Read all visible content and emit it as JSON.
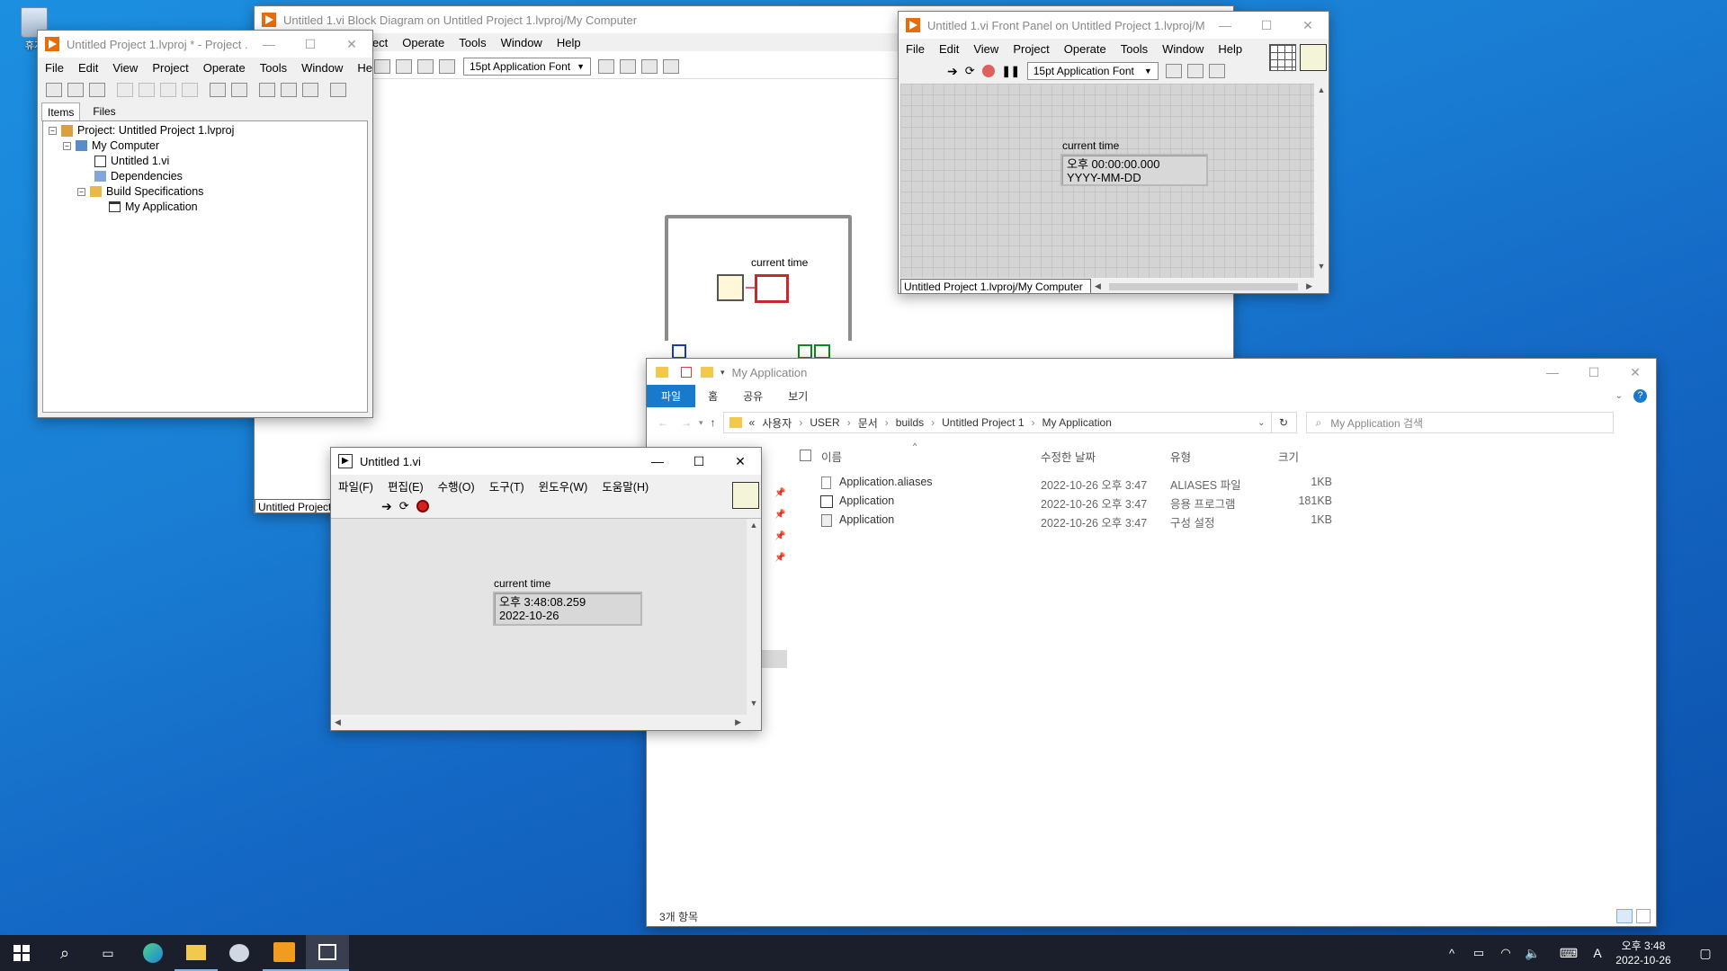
{
  "desktop": {
    "recycle_label": "휴지"
  },
  "project_window": {
    "title": "Untitled Project 1.lvproj * - Project ...",
    "menu": [
      "File",
      "Edit",
      "View",
      "Project",
      "Operate",
      "Tools",
      "Window",
      "Help"
    ],
    "tabs": [
      "Items",
      "Files"
    ],
    "tree": [
      "Project: Untitled Project 1.lvproj",
      "My Computer",
      "Untitled 1.vi",
      "Dependencies",
      "Build Specifications",
      "My Application"
    ]
  },
  "block_diagram": {
    "title": "Untitled 1.vi Block Diagram on Untitled Project 1.lvproj/My Computer",
    "menu": [
      "ject",
      "Operate",
      "Tools",
      "Window",
      "Help"
    ],
    "font": "15pt Application Font",
    "node_label": "current time",
    "status": "Untitled Project"
  },
  "front_panel": {
    "title": "Untitled 1.vi Front Panel on Untitled Project 1.lvproj/M...",
    "menu": [
      "File",
      "Edit",
      "View",
      "Project",
      "Operate",
      "Tools",
      "Window",
      "Help"
    ],
    "font": "15pt Application Font",
    "control_label": "current time",
    "control_time": "오후 00:00:00.000",
    "control_date": "YYYY-MM-DD",
    "status": "Untitled Project 1.lvproj/My Computer"
  },
  "running_vi": {
    "title": "Untitled 1.vi",
    "menu": [
      "파일(F)",
      "편집(E)",
      "수행(O)",
      "도구(T)",
      "윈도우(W)",
      "도움말(H)"
    ],
    "control_label": "current time",
    "control_time": "오후 3:48:08.259",
    "control_date": "2022-10-26"
  },
  "explorer": {
    "title": "My Application",
    "ribbon_tabs": [
      "파일",
      "홈",
      "공유",
      "보기"
    ],
    "breadcrumb": [
      "«",
      "사용자",
      "USER",
      "문서",
      "builds",
      "Untitled Project 1",
      "My Application"
    ],
    "search_placeholder": "My Application 검색",
    "columns": [
      "이름",
      "수정한 날짜",
      "유형",
      "크기"
    ],
    "files": [
      {
        "name": "Application.aliases",
        "date": "2022-10-26 오후 3:47",
        "type": "ALIASES 파일",
        "size": "1KB"
      },
      {
        "name": "Application",
        "date": "2022-10-26 오후 3:47",
        "type": "응용 프로그램",
        "size": "181KB"
      },
      {
        "name": "Application",
        "date": "2022-10-26 오후 3:47",
        "type": "구성 설정",
        "size": "1KB"
      }
    ],
    "status": "3개 항목"
  },
  "taskbar": {
    "time": "오후 3:48",
    "date": "2022-10-26",
    "ime": "A"
  }
}
